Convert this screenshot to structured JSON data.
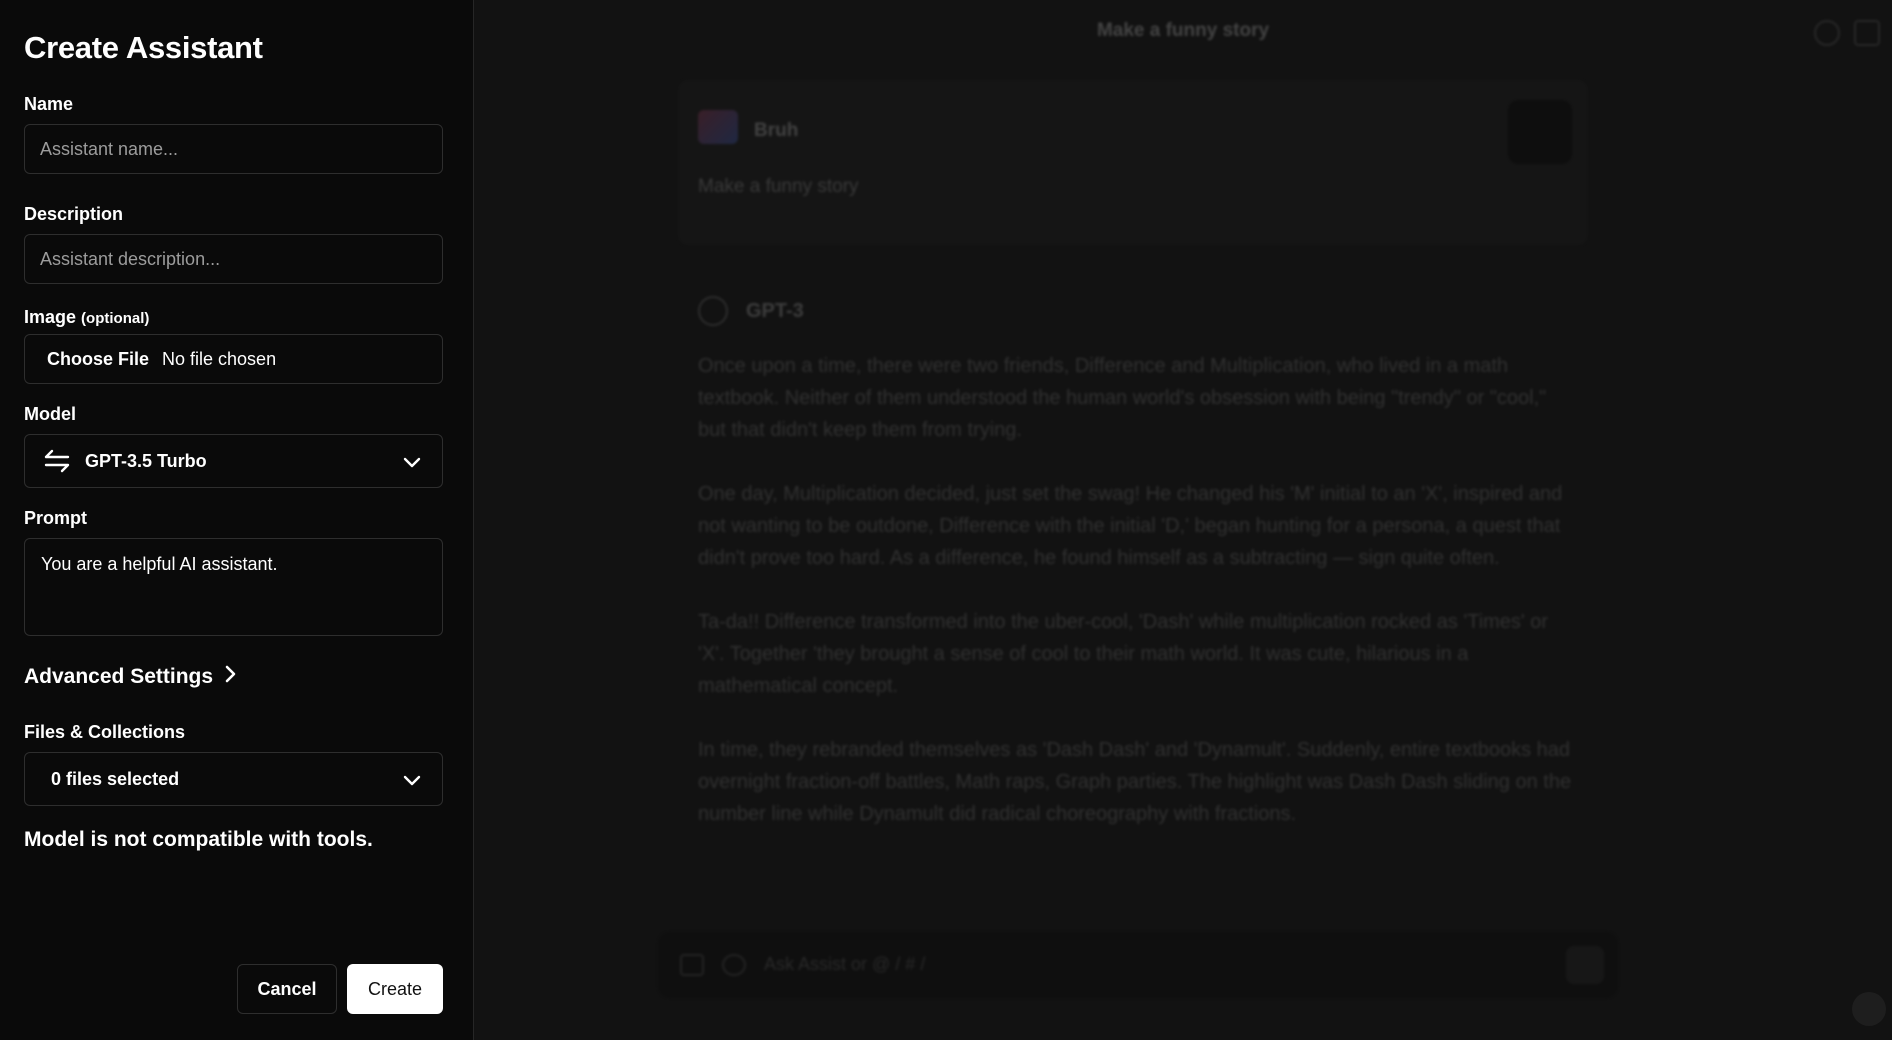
{
  "sheet": {
    "title": "Create Assistant",
    "name": {
      "label": "Name",
      "placeholder": "Assistant name...",
      "value": ""
    },
    "description": {
      "label": "Description",
      "placeholder": "Assistant description...",
      "value": ""
    },
    "image": {
      "label": "Image",
      "optional": "(optional)",
      "button": "Choose File",
      "status": "No file chosen"
    },
    "model": {
      "label": "Model",
      "selected": "GPT-3.5 Turbo",
      "icon": "arrows-swap-icon"
    },
    "prompt": {
      "label": "Prompt",
      "value": "You are a helpful AI assistant."
    },
    "advanced": {
      "label": "Advanced Settings",
      "icon": "chevron-right-icon"
    },
    "files": {
      "label": "Files & Collections",
      "selected": "0 files selected"
    },
    "warning": "Model is not compatible with tools.",
    "buttons": {
      "cancel": "Cancel",
      "create": "Create"
    }
  },
  "background": {
    "chat_title": "Make a funny story",
    "user_name": "Bruh",
    "user_message": "Make a funny story",
    "assistant_name": "GPT-3",
    "paragraphs": [
      "Once upon a time, there were two friends, Difference and Multiplication, who lived in a math textbook. Neither of them understood the human world's obsession with being \"trendy\" or \"cool,\" but that didn't keep them from trying.",
      "One day, Multiplication decided, just set the swag! He changed his 'M' initial to an 'X', inspired and not wanting to be outdone, Difference with the initial 'D,' began hunting for a persona, a quest that didn't prove too hard. As a difference, he found himself as a subtracting — sign quite often.",
      "Ta-da!! Difference transformed into the uber-cool, 'Dash' while multiplication rocked as 'Times' or 'X'. Together 'they brought a sense of cool to their math world. It was cute, hilarious in a mathematical concept.",
      "In time, they rebranded themselves as 'Dash Dash' and 'Dynamult'. Suddenly, entire textbooks had overnight fraction-off battles, Math raps, Graph parties. The highlight was Dash Dash sliding on the number line while Dynamult did radical choreography with fractions."
    ],
    "input_placeholder": "Ask Assist or @ / # /"
  },
  "colors": {
    "background": "#0a0a0a",
    "border": "#2e2e2e",
    "primary_button": "#ffffff"
  }
}
